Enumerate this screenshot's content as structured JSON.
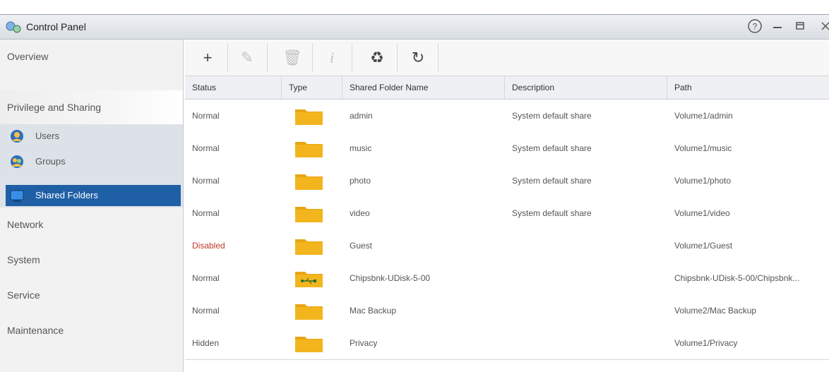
{
  "window": {
    "title": "Control Panel",
    "controls": {
      "help": "help-icon",
      "minimize": "minimize-icon",
      "maximize": "maximize-icon",
      "close": "close-icon"
    }
  },
  "sidebar": {
    "items": [
      {
        "label": "Overview"
      },
      {
        "label": "Privilege and Sharing"
      },
      {
        "label": "Network"
      },
      {
        "label": "System"
      },
      {
        "label": "Service"
      },
      {
        "label": "Maintenance"
      }
    ],
    "sub_items": [
      {
        "label": "Users",
        "icon": "users-icon"
      },
      {
        "label": "Groups",
        "icon": "groups-icon"
      },
      {
        "label": "Shared Folders",
        "icon": "shared-folders-icon"
      }
    ]
  },
  "toolbar": {
    "buttons": [
      {
        "glyph": "+",
        "icon": "add-icon",
        "enabled": true
      },
      {
        "glyph": "✎",
        "icon": "edit-icon",
        "enabled": false
      },
      {
        "glyph": "🗑",
        "icon": "delete-icon",
        "enabled": false
      },
      {
        "glyph": "i",
        "icon": "info-icon",
        "enabled": false
      },
      {
        "glyph": "♻",
        "icon": "recycle-icon",
        "enabled": true
      },
      {
        "glyph": "↻",
        "icon": "refresh-icon",
        "enabled": true
      }
    ]
  },
  "table": {
    "columns": [
      "Status",
      "Type",
      "Shared Folder Name",
      "Description",
      "Path"
    ],
    "rows": [
      {
        "status": "Normal",
        "type": "folder",
        "name": "admin",
        "description": "System default share",
        "path": "Volume1/admin"
      },
      {
        "status": "Normal",
        "type": "folder",
        "name": "music",
        "description": "System default share",
        "path": "Volume1/music"
      },
      {
        "status": "Normal",
        "type": "folder",
        "name": "photo",
        "description": "System default share",
        "path": "Volume1/photo"
      },
      {
        "status": "Normal",
        "type": "folder",
        "name": "video",
        "description": "System default share",
        "path": "Volume1/video"
      },
      {
        "status": "Disabled",
        "type": "folder",
        "name": "Guest",
        "description": "",
        "path": "Volume1/Guest"
      },
      {
        "status": "Normal",
        "type": "usb-folder",
        "name": "Chipsbnk-UDisk-5-00",
        "description": "",
        "path": "Chipsbnk-UDisk-5-00/Chipsbnk..."
      },
      {
        "status": "Normal",
        "type": "folder",
        "name": "Mac Backup",
        "description": "",
        "path": "Volume2/Mac Backup"
      },
      {
        "status": "Hidden",
        "type": "folder",
        "name": "Privacy",
        "description": "",
        "path": "Volume1/Privacy"
      }
    ]
  },
  "colors": {
    "accent": "#1f5fa6",
    "folder": "#f2b51e",
    "disabled_status": "#c0392b"
  }
}
